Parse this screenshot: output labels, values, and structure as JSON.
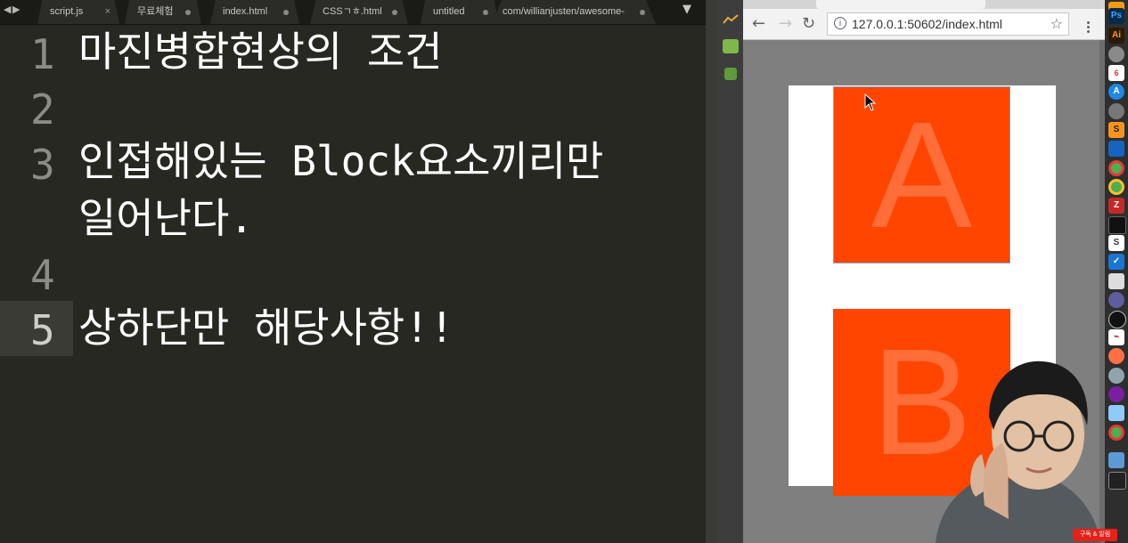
{
  "editor": {
    "tabs": [
      {
        "label": "script.js",
        "indicator": "close"
      },
      {
        "label": "무료체험",
        "indicator": "dot"
      },
      {
        "label": "index.html",
        "indicator": "dot"
      },
      {
        "label": "CSSㄱㅎ.html",
        "indicator": "dot"
      },
      {
        "label": "untitled",
        "indicator": "dot"
      },
      {
        "label": "com/willianjusten/awesome-",
        "indicator": "dot"
      }
    ],
    "lines": [
      {
        "number": "1",
        "text": "마진병합현상의 조건"
      },
      {
        "number": "2",
        "text": ""
      },
      {
        "number": "3",
        "text": "인접해있는 Block요소끼리만"
      },
      {
        "number": "",
        "text": "일어난다."
      },
      {
        "number": "4",
        "text": ""
      },
      {
        "number": "5",
        "text": "상하단만 해당사항!!"
      }
    ],
    "active_line": "5"
  },
  "browser": {
    "url": "127.0.0.1:50602/index.html",
    "boxes": [
      {
        "label": "A",
        "color": "#ff4500"
      },
      {
        "label": "B",
        "color": "#ff4500"
      }
    ]
  },
  "dock_icons": [
    "sublime-icon",
    "photoshop-icon",
    "illustrator-icon",
    "rocket-icon",
    "calendar-icon",
    "appstore-icon",
    "settings-icon",
    "sublime-icon",
    "sourcetree-icon",
    "chrome-icon",
    "chrome-icon",
    "filezilla-icon",
    "terminal-icon",
    "sketch-icon",
    "tasks-icon",
    "activity-icon",
    "keynote-icon",
    "iterm-icon",
    "acrobat-icon",
    "firefox-icon",
    "safari-icon",
    "itunes-icon",
    "preview-icon",
    "chrome-icon",
    "folder-icon",
    "terminal-icon"
  ],
  "overlay": {
    "subscribe_label": "구독 & 알림"
  }
}
